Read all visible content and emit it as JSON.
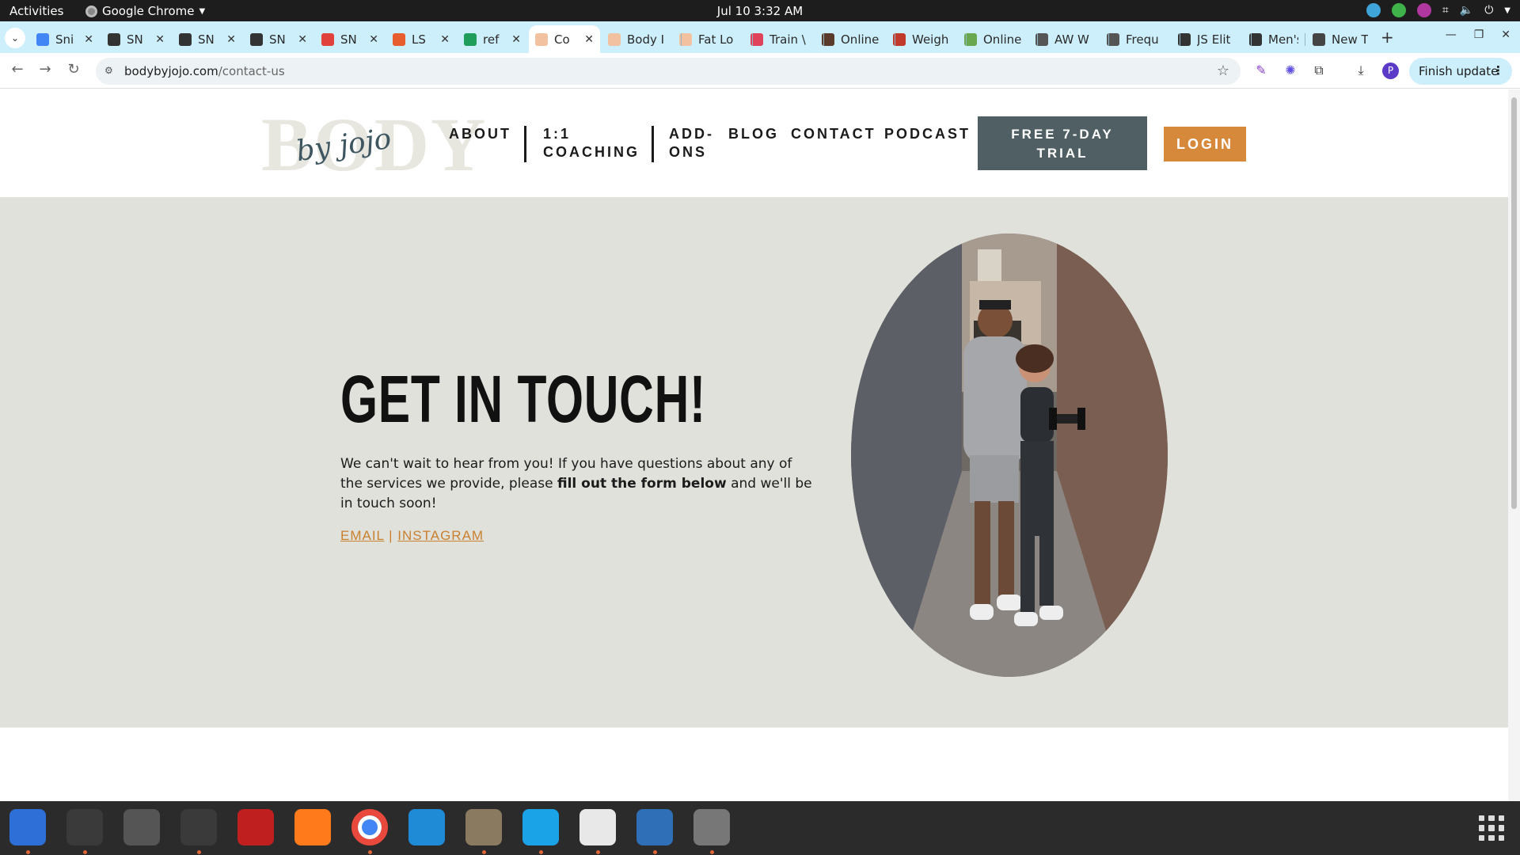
{
  "system": {
    "activities": "Activities",
    "app_name": "Google Chrome",
    "clock": "Jul 10  3:32 AM"
  },
  "tabs": [
    {
      "title": "Sni",
      "icon": "docs-icon",
      "color": "#4285f4"
    },
    {
      "title": "SN",
      "icon": "snp-icon",
      "color": "#333333"
    },
    {
      "title": "SN",
      "icon": "snp-icon",
      "color": "#333333"
    },
    {
      "title": "SN",
      "icon": "snp-icon",
      "color": "#333333"
    },
    {
      "title": "SN",
      "icon": "rainbow-icon",
      "color": "#e0423b"
    },
    {
      "title": "LS",
      "icon": "face-icon",
      "color": "#e85d2d"
    },
    {
      "title": "ref",
      "icon": "sheets-plus-icon",
      "color": "#1e9e5a"
    },
    {
      "title": "Co",
      "icon": "peach-icon",
      "color": "#f2c2a0",
      "active": true
    },
    {
      "title": "Body I",
      "icon": "peach-icon",
      "color": "#f2c2a0"
    },
    {
      "title": "Fat Lo",
      "icon": "peach-icon",
      "color": "#f2c2a0"
    },
    {
      "title": "Train \\",
      "icon": "heart-icon",
      "color": "#e0425b"
    },
    {
      "title": "Online",
      "icon": "person-icon",
      "color": "#5a3a2a"
    },
    {
      "title": "Weigh",
      "icon": "person-red-icon",
      "color": "#c0392b"
    },
    {
      "title": "Online",
      "icon": "image-icon",
      "color": "#6aa84f"
    },
    {
      "title": "AW W",
      "icon": "chart-icon",
      "color": "#555555"
    },
    {
      "title": "Frequ",
      "icon": "chart-icon",
      "color": "#555555"
    },
    {
      "title": "JS Elit",
      "icon": "shield-icon",
      "color": "#333333"
    },
    {
      "title": "Men's",
      "icon": "shield-icon",
      "color": "#333333"
    },
    {
      "title": "New T",
      "icon": "globe-icon",
      "color": "#444444"
    }
  ],
  "toolbar": {
    "url_host": "bodybyjojo.com",
    "url_path": "/contact-us",
    "finish_update": "Finish update",
    "profile_initial": "P"
  },
  "site": {
    "logo_big": "BODY",
    "logo_script": "by jojo",
    "nav": {
      "about": "ABOUT",
      "coaching_1": "1:1",
      "coaching_2": "COACHING",
      "addons_1": "ADD-",
      "addons_2": "ONS",
      "blog": "BLOG",
      "contact": "CONTACT",
      "podcast": "PODCAST"
    },
    "trial_1": "FREE 7-DAY",
    "trial_2": "TRIAL",
    "login": "LOGIN"
  },
  "hero": {
    "heading": "GET IN TOUCH!",
    "lead_1": "We can't wait to hear from you! If you have questions about any of the services we provide, please ",
    "lead_bold": "fill out the form below",
    "lead_2": " and we'll be in touch soon!",
    "email_link": "EMAIL",
    "separator": " | ",
    "instagram_link": "INSTAGRAM"
  },
  "colors": {
    "hero_bg": "#e0e1db",
    "trial_bg": "#4f5f63",
    "login_bg": "#d6893a",
    "link": "#c9802f",
    "tab_strip": "#cdeefb"
  },
  "dock": [
    {
      "name": "thunderbird-icon",
      "color": "#2d6fd6"
    },
    {
      "name": "terminal-icon",
      "color": "#3a3a3a"
    },
    {
      "name": "calculator-icon",
      "color": "#555555"
    },
    {
      "name": "system-monitor-icon",
      "color": "#3a3a3a"
    },
    {
      "name": "filezilla-icon",
      "color": "#bf1f1f"
    },
    {
      "name": "firefox-icon",
      "color": "#ff7a1a"
    },
    {
      "name": "chrome-icon",
      "color": "#4285f4"
    },
    {
      "name": "vscode-icon",
      "color": "#1f8ad6"
    },
    {
      "name": "files-icon",
      "color": "#8a7b60"
    },
    {
      "name": "skype-icon",
      "color": "#1ba3e8"
    },
    {
      "name": "text-editor-icon",
      "color": "#e8e8e8"
    },
    {
      "name": "document-viewer-icon",
      "color": "#2f6fb8"
    },
    {
      "name": "disk-icon",
      "color": "#777777"
    }
  ]
}
